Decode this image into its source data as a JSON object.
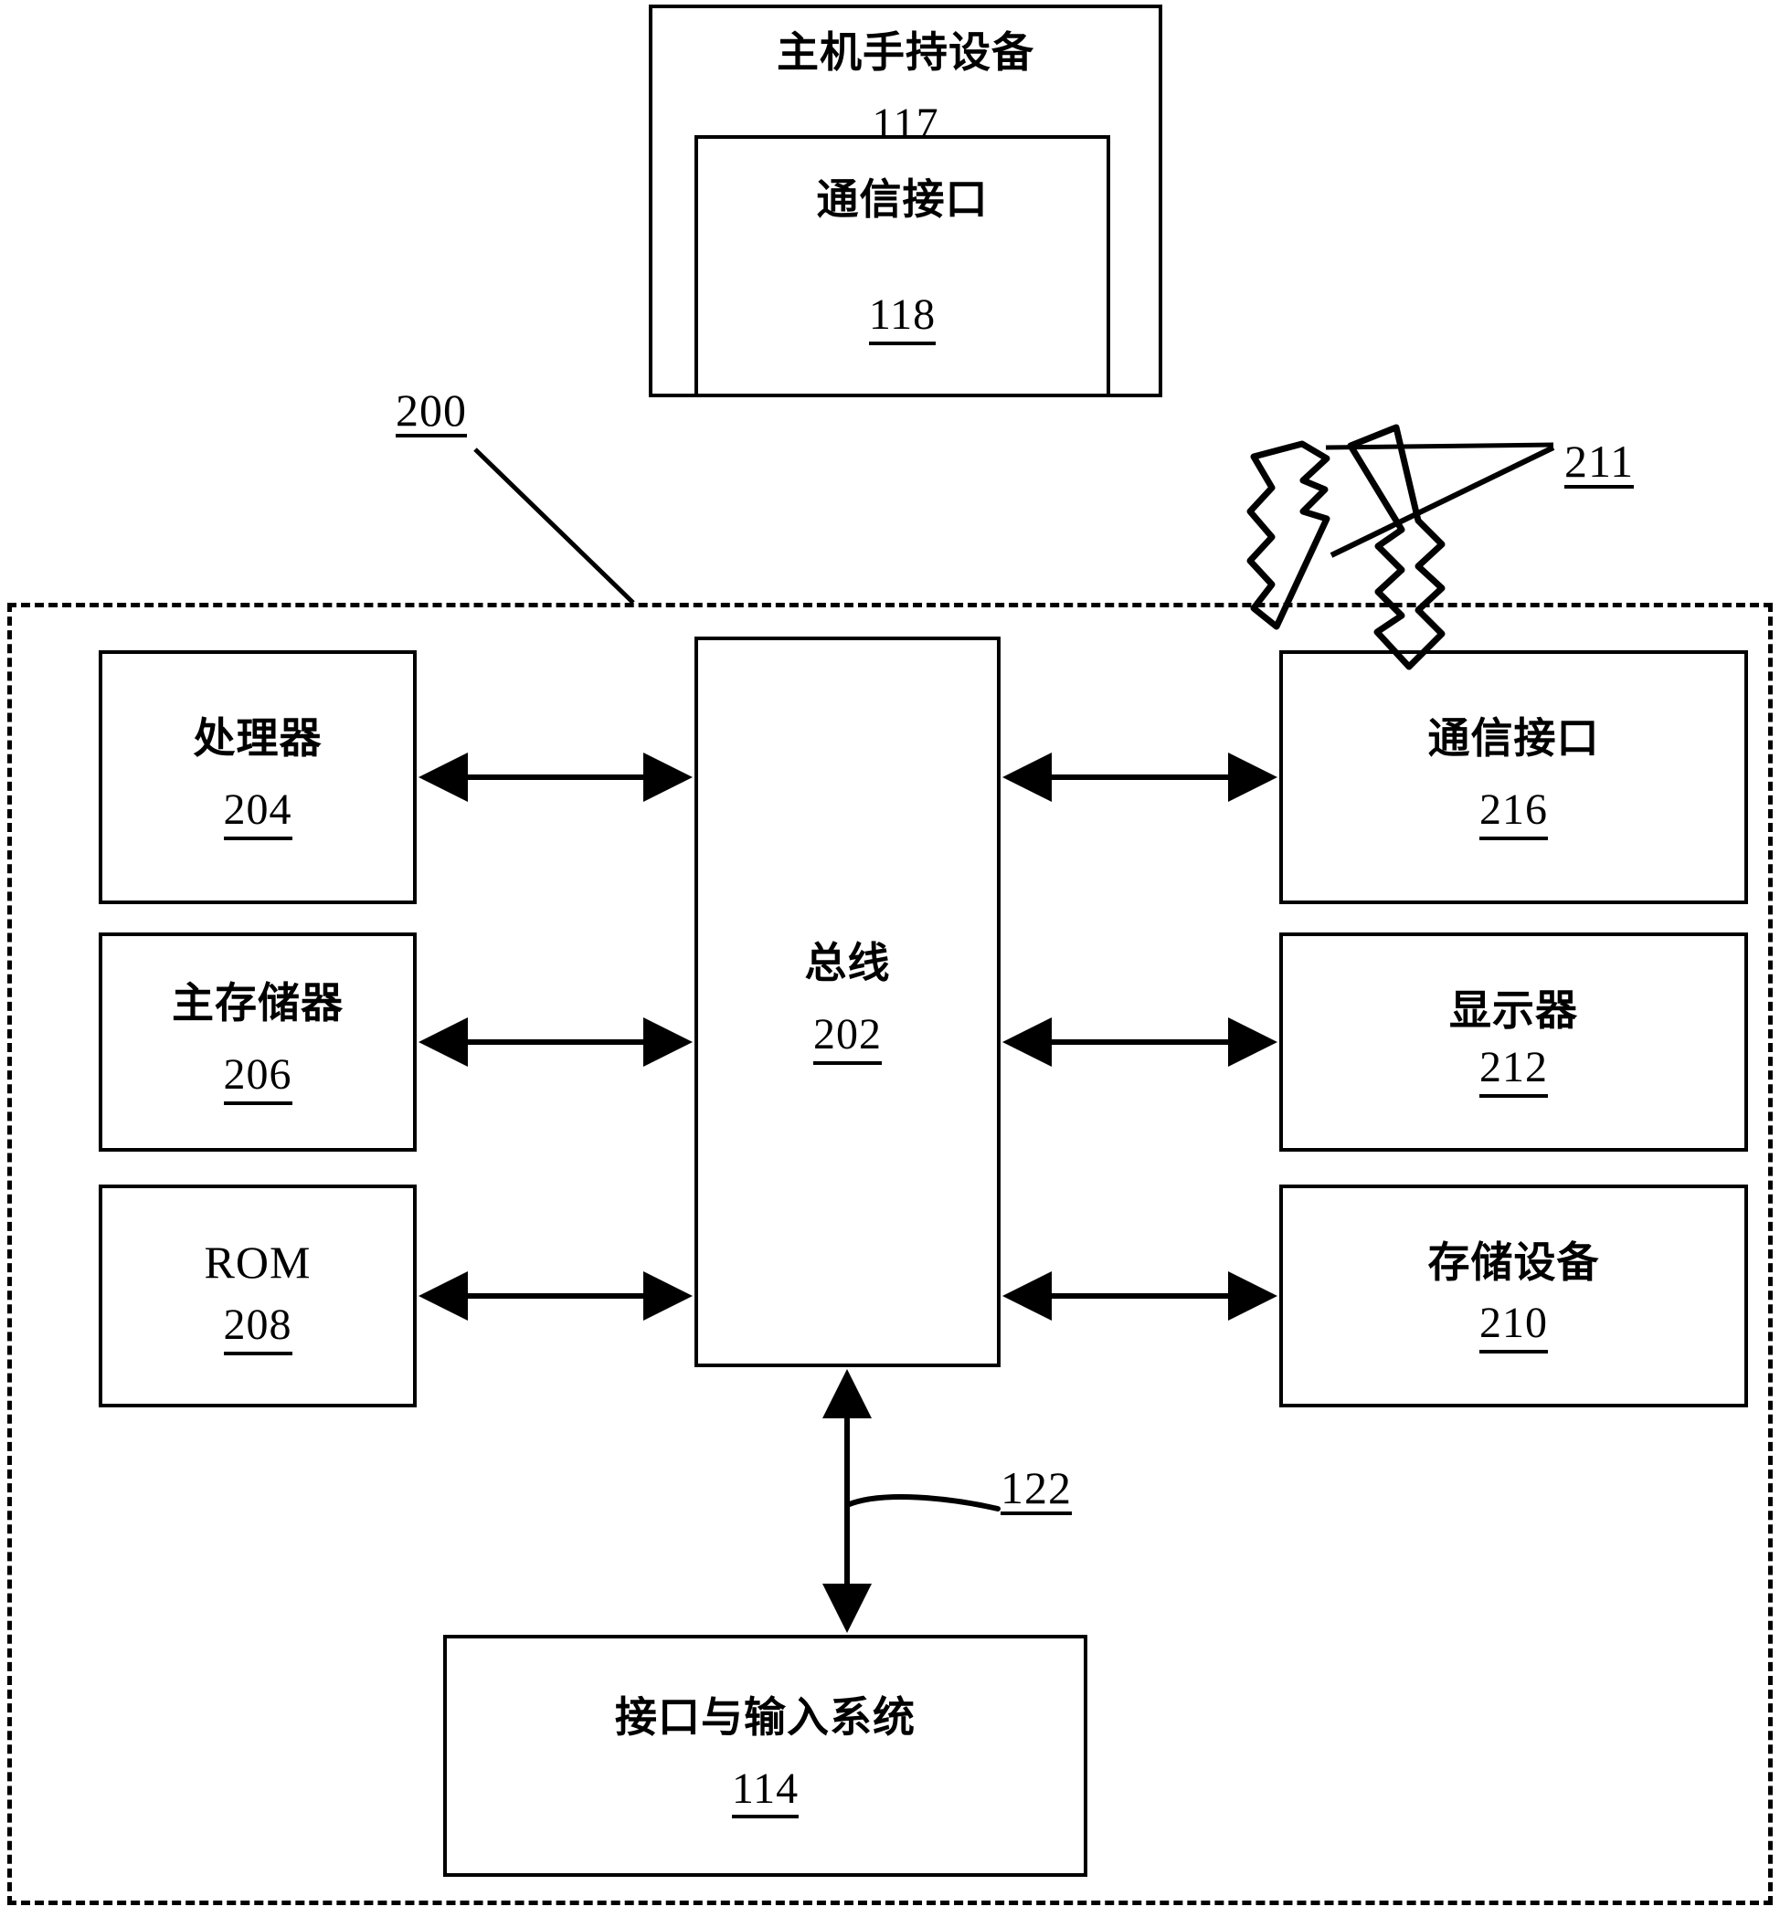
{
  "figure": {
    "host_device": {
      "label": "主机手持设备",
      "refnum": "117"
    },
    "host_comm_interface": {
      "label": "通信接口",
      "refnum": "118"
    },
    "wireless_link": {
      "refnum": "211",
      "icon": "lightning-bolt-icon"
    },
    "system_enclosure": {
      "refnum": "200"
    },
    "bus": {
      "label": "总线",
      "refnum": "202"
    },
    "left_column": [
      {
        "label": "处理器",
        "refnum": "204"
      },
      {
        "label": "主存储器",
        "refnum": "206"
      },
      {
        "label": "ROM",
        "refnum": "208",
        "latin": true
      }
    ],
    "right_column": [
      {
        "label": "通信接口",
        "refnum": "216"
      },
      {
        "label": "显示器",
        "refnum": "212"
      },
      {
        "label": "存储设备",
        "refnum": "210"
      }
    ],
    "bottom_block": {
      "label": "接口与输入系统",
      "refnum": "114"
    },
    "bus_to_interface_link": {
      "refnum": "122"
    }
  }
}
